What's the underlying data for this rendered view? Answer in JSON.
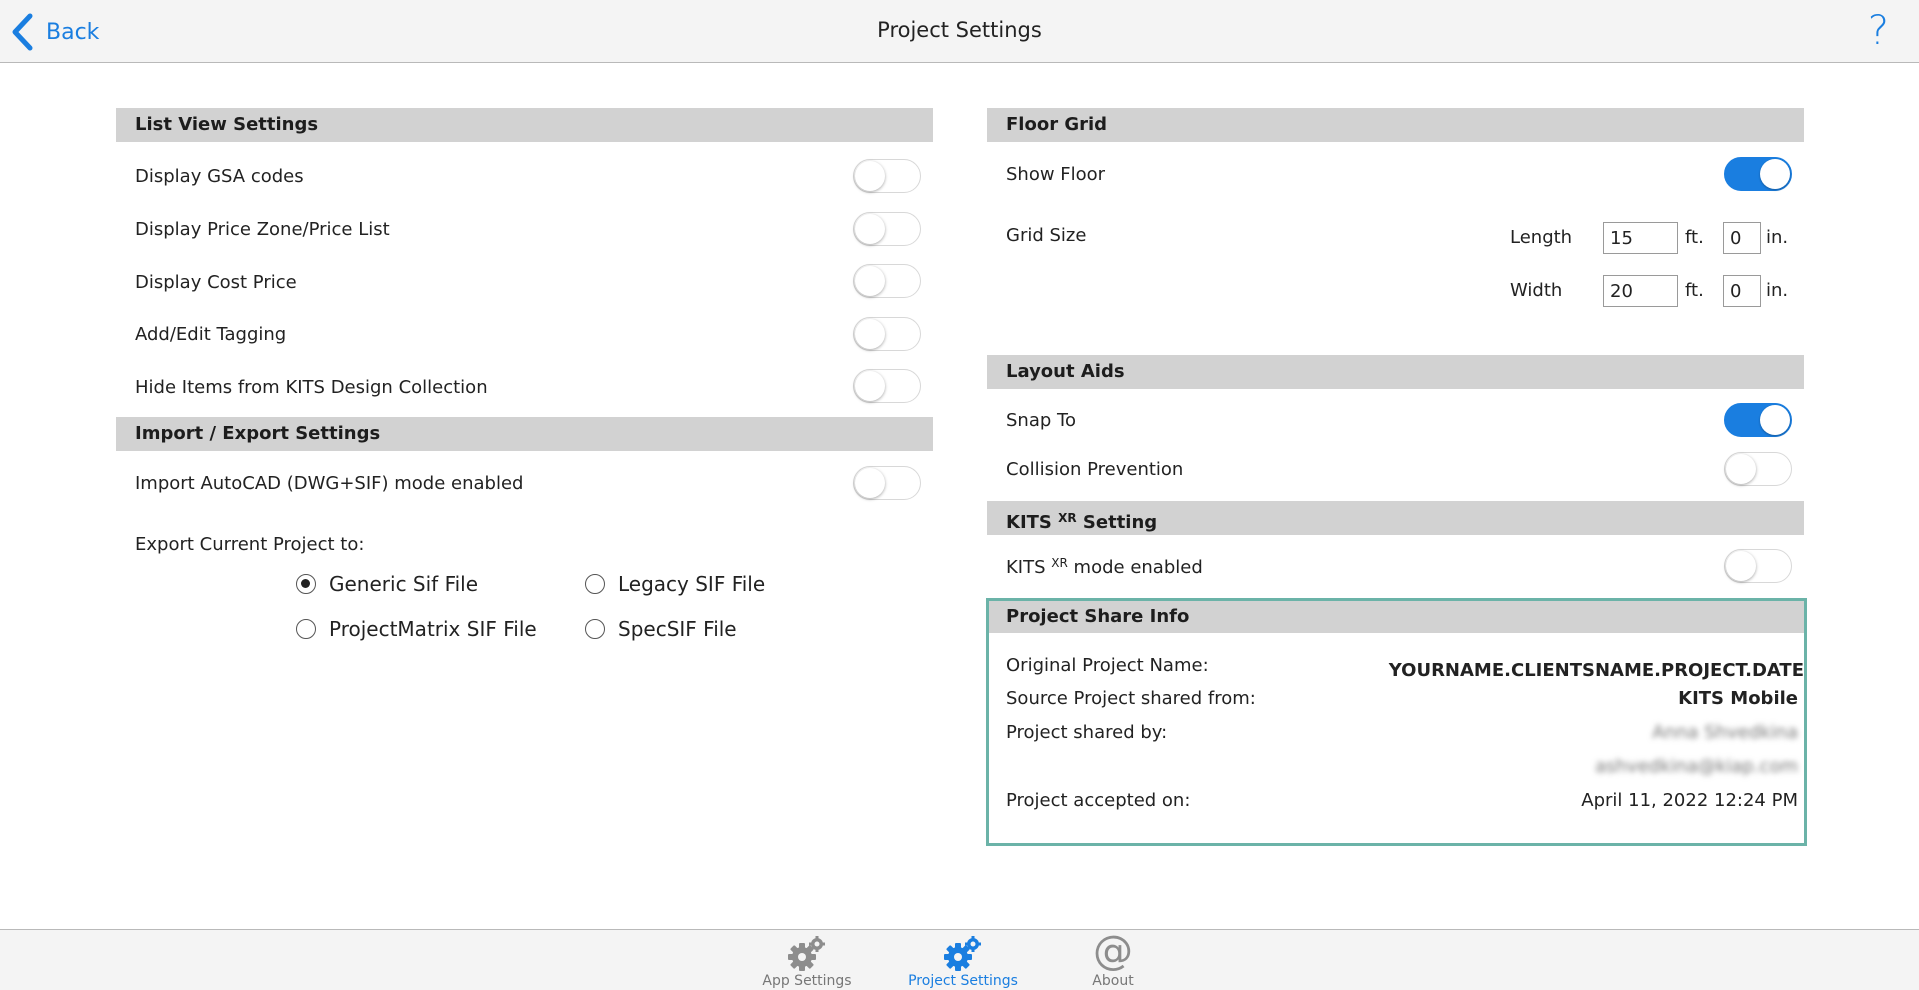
{
  "header": {
    "back_label": "Back",
    "title": "Project Settings",
    "help_icon": "?"
  },
  "list_view": {
    "title": "List View Settings",
    "items": [
      {
        "label": "Display GSA codes",
        "on": false
      },
      {
        "label": "Display Price Zone/Price List",
        "on": false
      },
      {
        "label": "Display Cost Price",
        "on": false
      },
      {
        "label": "Add/Edit Tagging",
        "on": false
      },
      {
        "label": "Hide Items from KITS Design Collection",
        "on": false
      }
    ]
  },
  "import_export": {
    "title": "Import / Export Settings",
    "autocad_label": "Import AutoCAD (DWG+SIF) mode enabled",
    "autocad_on": false,
    "export_label": "Export Current Project to:",
    "options": [
      {
        "label": "Generic Sif File",
        "selected": true
      },
      {
        "label": "Legacy SIF File",
        "selected": false
      },
      {
        "label": "ProjectMatrix SIF File",
        "selected": false
      },
      {
        "label": "SpecSIF File",
        "selected": false
      }
    ]
  },
  "floor_grid": {
    "title": "Floor Grid",
    "show_floor_label": "Show Floor",
    "show_floor_on": true,
    "grid_size_label": "Grid Size",
    "length_label": "Length",
    "length_ft": "15",
    "length_in": "0",
    "width_label": "Width",
    "width_ft": "20",
    "width_in": "0",
    "ft_unit": "ft.",
    "in_unit": "in."
  },
  "layout_aids": {
    "title": "Layout Aids",
    "snap_label": "Snap To",
    "snap_on": true,
    "collision_label": "Collision Prevention",
    "collision_on": false
  },
  "kits_xr": {
    "title_prefix": "KITS ",
    "title_sup": "XR",
    "title_suffix": " Setting",
    "mode_prefix": "KITS ",
    "mode_sup": "XR",
    "mode_suffix": " mode enabled",
    "mode_on": false
  },
  "share_info": {
    "title": "Project Share Info",
    "original_name_label": "Original Project Name:",
    "original_name_value": "YOURNAME.CLIENTSNAME.PROJECT.DATE",
    "source_label": "Source Project shared from:",
    "source_value": "KITS Mobile",
    "shared_by_label": "Project shared by:",
    "shared_by_name": "Anna Shvedkina",
    "shared_by_email": "ashvedkina@kiap.com",
    "accepted_label": "Project accepted on:",
    "accepted_value": "April 11, 2022 12:24 PM"
  },
  "tabs": [
    {
      "label": "App Settings",
      "icon": "gear-icon",
      "active": false
    },
    {
      "label": "Project Settings",
      "icon": "gear-icon",
      "active": true
    },
    {
      "label": "About",
      "icon": "at-icon",
      "active": false
    }
  ],
  "colors": {
    "accent": "#1a7ee0",
    "header_bg": "#d2d2d2",
    "share_border": "#6bb3a8"
  }
}
